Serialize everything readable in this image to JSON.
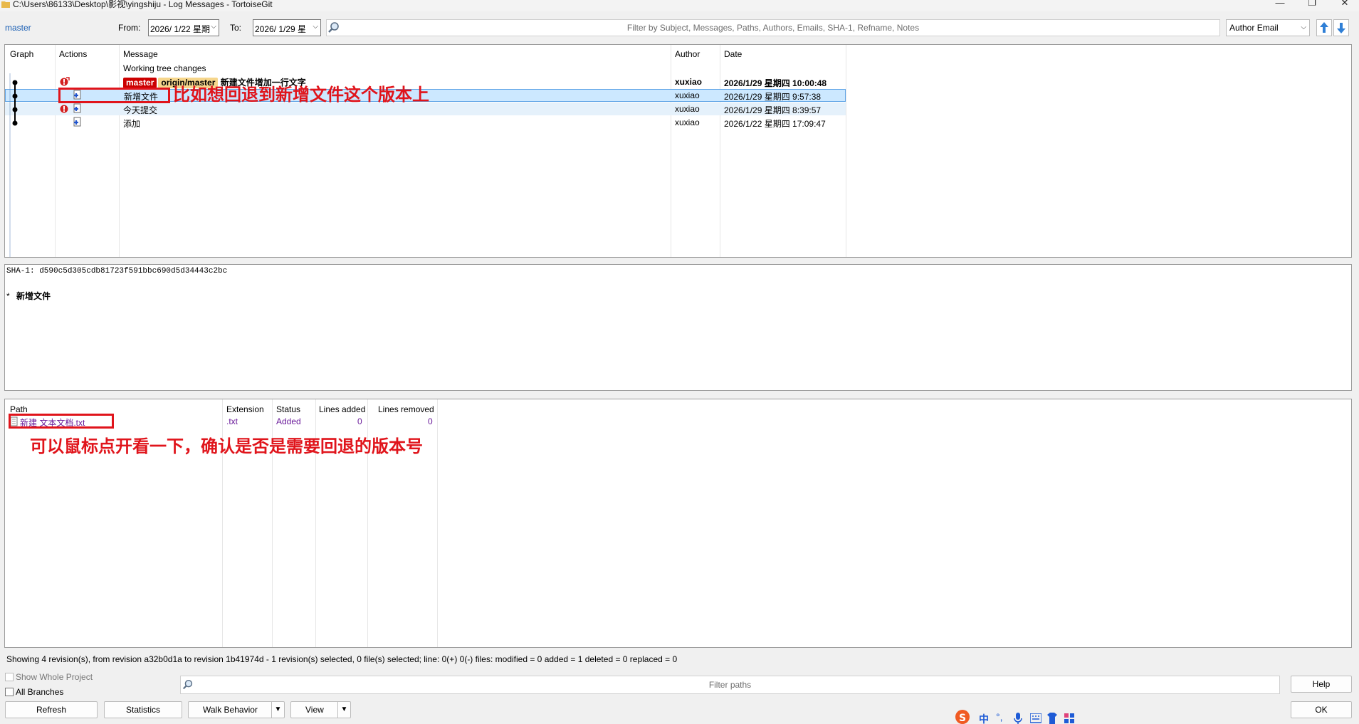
{
  "window": {
    "title": "C:\\Users\\86133\\Desktop\\影视\\yingshiju - Log Messages - TortoiseGit",
    "minimize": "—",
    "restore": "❐",
    "close": "✕"
  },
  "toolbar": {
    "branch": "master",
    "from_label": "From:",
    "from_value": "2026/  1/22 星期",
    "to_label": "To:",
    "to_value": "2026/  1/29 星",
    "filter_placeholder": "Filter by Subject, Messages, Paths, Authors, Emails, SHA-1, Refname, Notes",
    "author_select": "Author Email"
  },
  "log": {
    "headers": {
      "graph": "Graph",
      "actions": "Actions",
      "message": "Message",
      "author": "Author",
      "date": "Date"
    },
    "working_tree": "Working tree changes",
    "rows": [
      {
        "tag1": "master",
        "tag2": "origin/master",
        "message": "新建文件增加一行文字",
        "author": "xuxiao",
        "date": "2026/1/29 星期四 10:00:48"
      },
      {
        "message": "新增文件",
        "author": "xuxiao",
        "date": "2026/1/29 星期四 9:57:38"
      },
      {
        "message": "今天提交",
        "author": "xuxiao",
        "date": "2026/1/29 星期四 8:39:57"
      },
      {
        "message": "添加",
        "author": "xuxiao",
        "date": "2026/1/22 星期四 17:09:47"
      }
    ]
  },
  "annotations": {
    "top": "比如想回退到新增文件这个版本上",
    "bottom": "可以鼠标点开看一下，确认是否是需要回退的版本号"
  },
  "message_pane": {
    "sha": "SHA-1: d590c5d305cdb81723f591bbc690d5d34443c2bc",
    "bullet": "*",
    "subject": "新增文件"
  },
  "files": {
    "headers": {
      "path": "Path",
      "extension": "Extension",
      "status": "Status",
      "lines_added": "Lines added",
      "lines_removed": "Lines removed"
    },
    "rows": [
      {
        "path": "新建 文本文档.txt",
        "extension": ".txt",
        "status": "Added",
        "lines_added": "0",
        "lines_removed": "0"
      }
    ]
  },
  "status": "Showing 4 revision(s), from revision a32b0d1a to revision 1b41974d - 1 revision(s) selected, 0 file(s) selected; line: 0(+) 0(-) files: modified = 0 added = 1 deleted = 0 replaced = 0",
  "options": {
    "show_whole_project": "Show Whole Project",
    "all_branches": "All Branches"
  },
  "path_filter_placeholder": "Filter paths",
  "buttons": {
    "refresh": "Refresh",
    "statistics": "Statistics",
    "walk_behavior": "Walk Behavior",
    "view": "View",
    "help": "Help",
    "ok": "OK"
  },
  "ime": {
    "zh": "中"
  },
  "colors": {
    "accent": "#1a5fb4",
    "annotation": "#e0141b",
    "selected": "#cce8ff",
    "tag_master": "#cc0000",
    "tag_origin": "#f6d68c"
  }
}
